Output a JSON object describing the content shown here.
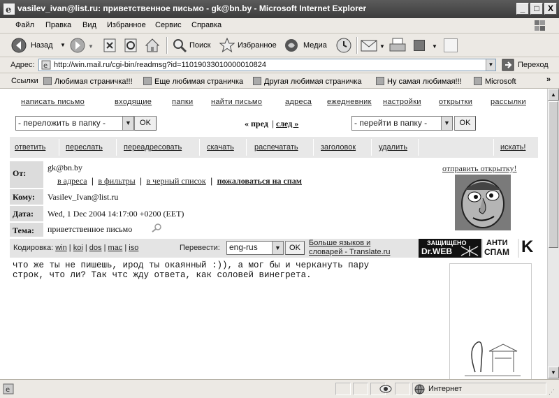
{
  "window": {
    "title": "vasilev_ivan@list.ru: приветственное письмо - gk@bn.by - Microsoft Internet Explorer",
    "min": "_",
    "max": "□",
    "close": "X"
  },
  "menu": [
    "Файл",
    "Правка",
    "Вид",
    "Избранное",
    "Сервис",
    "Справка"
  ],
  "toolbar": {
    "back": "Назад",
    "search": "Поиск",
    "favorites": "Избранное",
    "media": "Медиа"
  },
  "address": {
    "label": "Адрес:",
    "url": "http://win.mail.ru/cgi-bin/readmsg?id=11019033010000010824",
    "go": "Переход"
  },
  "links": {
    "label": "Ссылки",
    "items": [
      "Любимая страничка!!!",
      "Еще любимая страничка",
      "Другая любимая страничка",
      "Ну самая любимая!!!",
      "Microsoft"
    ]
  },
  "mail": {
    "topnav": [
      "написать письмо",
      "входящие",
      "папки",
      "найти письмо",
      "адреса",
      "ежедневник",
      "настройки",
      "открытки",
      "рассылки"
    ],
    "move_select": "- переложить в папку -",
    "ok": "OK",
    "prev": "« пред",
    "next": "след »",
    "goto_select": "- перейти в папку -",
    "actions": [
      "ответить",
      "переслать",
      "переадресовать",
      "скачать",
      "распечатать",
      "заголовок",
      "удалить"
    ],
    "search_link": "искать!",
    "header": {
      "from_label": "От:",
      "from": "gk@bn.by",
      "filters": [
        "в адреса",
        "в фильтры",
        "в черный список"
      ],
      "spam": "пожаловаться на спам",
      "to_label": "Кому:",
      "to": "Vasilev_Ivan@list.ru",
      "date_label": "Дата:",
      "date": "Wed, 1 Dec 2004 14:17:00 +0200 (EET)",
      "subject_label": "Тема:",
      "subject": "приветственное письмо",
      "send_card": "отправить открытку!"
    },
    "encoding": {
      "label": "Кодировка:",
      "options": [
        "win",
        "koi",
        "dos",
        "mac",
        "iso"
      ],
      "translate_label": "Перевести:",
      "translate_value": "eng-rus",
      "more_langs_1": "Больше языков и",
      "more_langs_2": "словарей - Translate.ru",
      "badge_protected": "ЗАЩИЩЕНО",
      "badge_drweb": "Dr.WEB",
      "badge_anti": "АНТИ",
      "badge_spam": "СПАМ",
      "badge_k": "K"
    },
    "body": "что же ты не пишешь, ирод ты окаянный :)), а мог бы и черкануть пару\nстрок, что ли? Так чтс жду ответа, как соловей винегрета."
  },
  "status": {
    "zone": "Интернет"
  }
}
